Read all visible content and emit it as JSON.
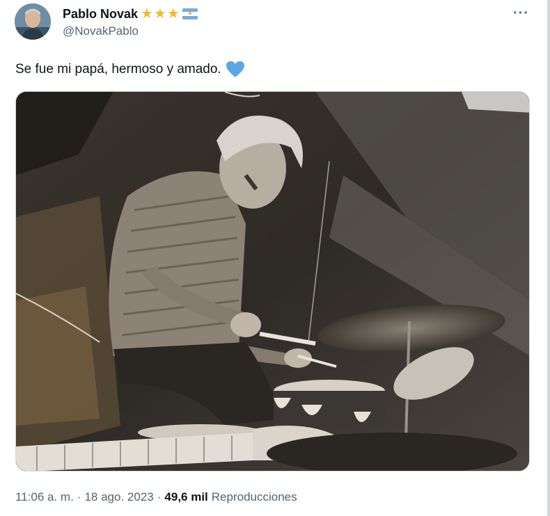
{
  "author": {
    "name": "Pablo Novak",
    "handle": "@NovakPablo",
    "badges": [
      "star-icon",
      "star-icon",
      "star-icon",
      "argentina-flag-icon"
    ],
    "star_color": "#f5b82e"
  },
  "tweet": {
    "text": "Se fue mi papá, hermoso y amado.",
    "emoji": "blue-heart-icon",
    "emoji_color": "#5aa6e6"
  },
  "meta": {
    "time": "11:06 a. m.",
    "separator": "·",
    "date": "18 ago. 2023",
    "views_count": "49,6 mil",
    "views_label": "Reproducciones"
  },
  "menu": {
    "more_label": "···"
  },
  "colors": {
    "text": "#0f1419",
    "secondary": "#536471",
    "border": "#cfd9de"
  }
}
